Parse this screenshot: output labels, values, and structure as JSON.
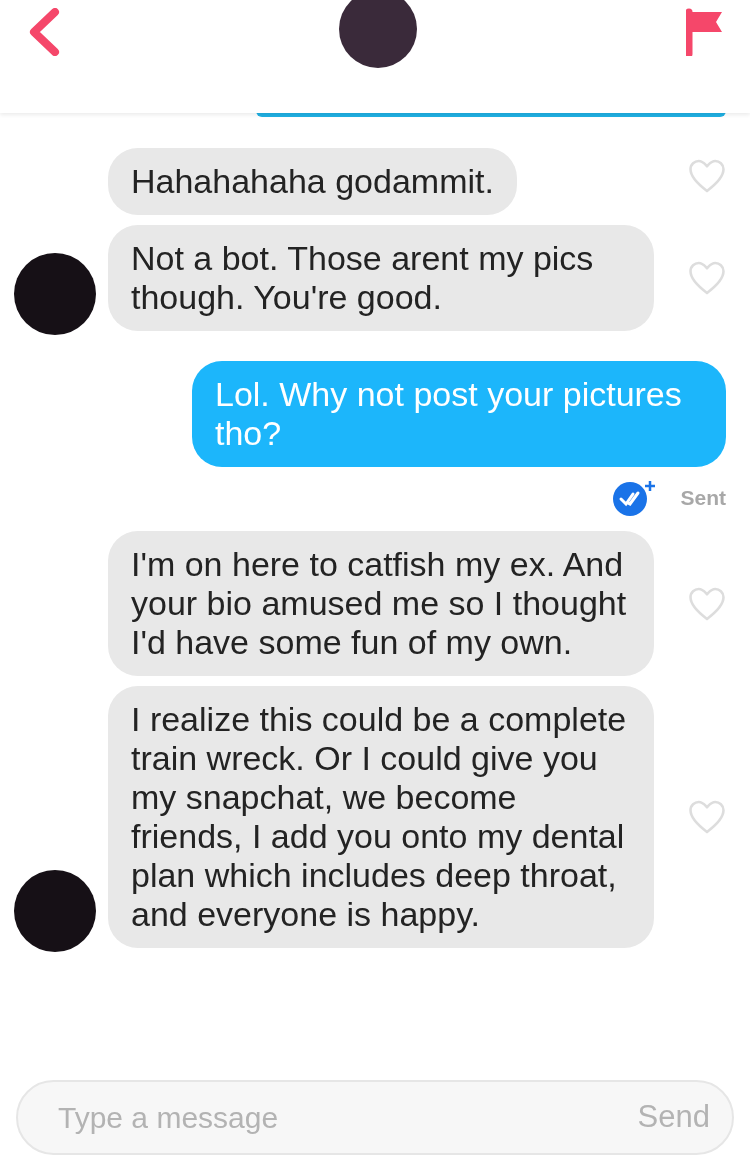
{
  "messages": [
    {
      "kind": "incoming",
      "text": "Hahahahaha godammit.",
      "avatar": false,
      "liked": false
    },
    {
      "kind": "incoming",
      "text": "Not a bot. Those arent my pics though. You're good.",
      "avatar": true,
      "liked": false
    },
    {
      "kind": "outgoing",
      "text": "Lol. Why not post your pictures tho?",
      "status": "Sent",
      "read": true
    },
    {
      "kind": "incoming",
      "text": "I'm on here to catfish my ex. And your bio amused me so I thought I'd have some fun of my own.",
      "avatar": false,
      "liked": false
    },
    {
      "kind": "incoming",
      "text": "I realize this could be a complete train wreck. Or I could give you my snapchat, we become friends, I add you onto my dental plan which includes deep throat, and everyone is happy.",
      "avatar": true,
      "liked": false
    }
  ],
  "composer": {
    "placeholder": "Type a message",
    "send": "Send"
  }
}
